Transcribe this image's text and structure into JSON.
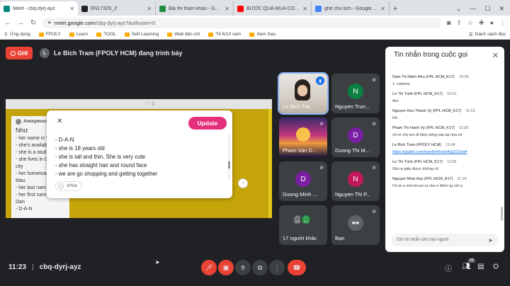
{
  "browser": {
    "tabs": [
      {
        "label": "Meet - cbq-dyrj-ayz",
        "color": "#00897b",
        "active": true
      },
      {
        "label": "EN17329_2",
        "color": "#222222",
        "active": false
      },
      {
        "label": "Bài thi tham khảo - Google Drive",
        "color": "#1e8e3e",
        "active": false
      },
      {
        "label": "BƯỚC QUA MÙA CÔ ĐƠN | VŨ",
        "color": "#ff0000",
        "active": false
      },
      {
        "label": "ghế chủ tịch - Google Tìm kiếm",
        "color": "#4285f4",
        "active": false
      }
    ],
    "url_host": "meet.google.com",
    "url_path": "/cbq-dyrj-ayz?authuser=0",
    "bookmarks": [
      "Ứng dụng",
      "FPOLY",
      "Learn",
      "TOOL",
      "Self Learning",
      "Web tiện ích",
      "T4 6/10 sem",
      "Xem Sau"
    ],
    "reading_list": "Danh sách đọc"
  },
  "meet": {
    "rec_label": "GHI",
    "presenter_initial": "L",
    "presenter_text": "Le Bich Tram (FPOLY HCM) đang trình bày",
    "shared": {
      "heart_count": "0",
      "card_author": "Anonymous",
      "card_title": "Như",
      "card_lines": [
        "- her name is V",
        "- she's availab",
        "- she is a stud",
        "- she lives in C",
        "city",
        "- her hometow",
        "Mau",
        "- her last nam",
        "- her first nam",
        "Dan",
        "- D-A-N"
      ],
      "update_label": "Update",
      "editor_lines": [
        "- D-A-N",
        "- she is 18 years old",
        "- she is tall and thin. She is very cute",
        "- she has straight hair and round face",
        "- we are go shopping and getting together"
      ],
      "color_label": "White"
    },
    "tiles": [
      {
        "name": "Le Bich Tra...",
        "type": "photo",
        "speaking": true
      },
      {
        "name": "Nguyen Trun...",
        "initial": "N",
        "color": "#0b8043"
      },
      {
        "name": "Pham Van D...",
        "type": "sunset"
      },
      {
        "name": "Duong Thi M...",
        "initial": "D",
        "color": "#7b1fa2"
      },
      {
        "name": "Duong Minh ...",
        "initial": "D",
        "color": "#7b1fa2"
      },
      {
        "name": "Nguyen Thi P...",
        "initial": "N",
        "color": "#c2185b"
      },
      {
        "name": "17 người khác",
        "type": "others"
      },
      {
        "name": "Bạn",
        "type": "you"
      }
    ],
    "chat": {
      "title": "Tin nhắn trong cuộc gọi",
      "messages": [
        {
          "sender": "Dam Thi Minh Nhu (FPL HCM_K17)",
          "time": "10:34",
          "text": "1. camera"
        },
        {
          "sender": "Le Thi Trinh (FPL HCM_K17)",
          "time": "10:51",
          "text": "Are"
        },
        {
          "sender": "Nguyen Huu Thanh Vy (FPL HCM_K17)",
          "time": "11:01",
          "text": "Ho"
        },
        {
          "sender": "Pham Thi Hanh Vy (FPL HCM_K17)",
          "time": "11:03",
          "text": "cô ơi cho em đi tiềm sống vào lại nha cô"
        },
        {
          "sender": "Le Bich Tram (FPOLY HCM)",
          "time": "11:04",
          "text": "https://padlet.com/tramlb4/6xxel4sj2013yit4",
          "link": true
        },
        {
          "sender": "Le Thi Trinh (FPL HCM_K17)",
          "time": "11:05",
          "text": "Ghi ra giấy được không cô"
        },
        {
          "sender": "Nguyen Nhat Huy (FPL HCM_K17)",
          "time": "11:15",
          "text": "Cô ơi e mới bị out ra cho e thêm tg với ạ"
        }
      ],
      "input_placeholder": "Gửi tin nhắn cho mọi người"
    },
    "bottom": {
      "time": "11:23",
      "meeting_code": "cbq-dyrj-ayz",
      "participant_count": "25"
    }
  }
}
